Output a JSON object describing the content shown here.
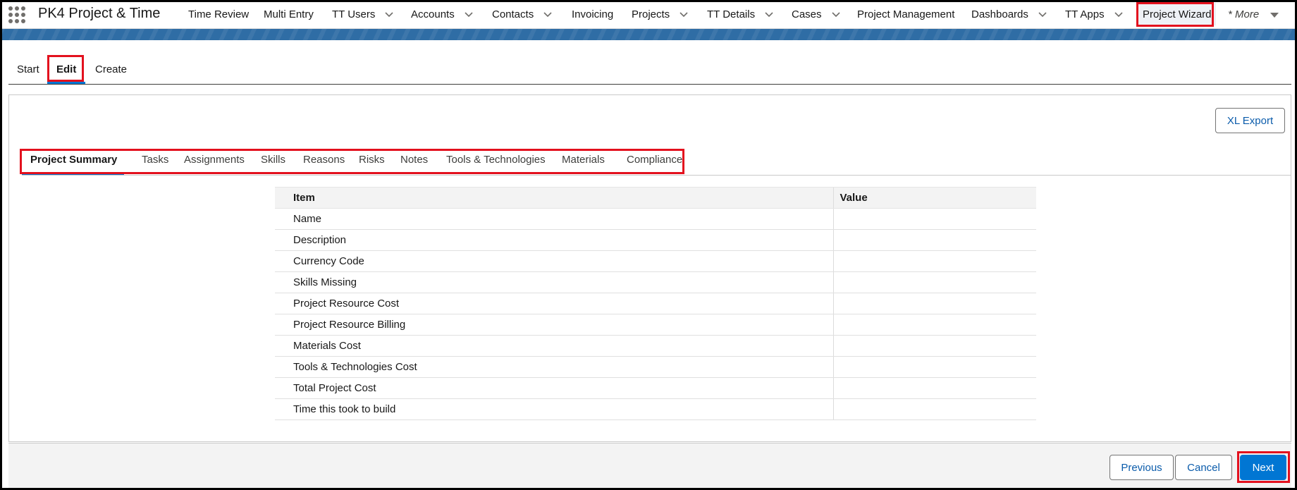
{
  "app": {
    "name": "PK4 Project & Time"
  },
  "nav": {
    "items": [
      {
        "label": "Time Review",
        "dropdown": false
      },
      {
        "label": "Multi Entry",
        "dropdown": false
      },
      {
        "label": "TT Users",
        "dropdown": true
      },
      {
        "label": "Accounts",
        "dropdown": true
      },
      {
        "label": "Contacts",
        "dropdown": true
      },
      {
        "label": "Invoicing",
        "dropdown": false
      },
      {
        "label": "Projects",
        "dropdown": true
      },
      {
        "label": "TT Details",
        "dropdown": true
      },
      {
        "label": "Cases",
        "dropdown": true
      },
      {
        "label": "Project Management",
        "dropdown": false
      },
      {
        "label": "Dashboards",
        "dropdown": true
      },
      {
        "label": "TT Apps",
        "dropdown": true
      },
      {
        "label": "Project Wizard",
        "dropdown": false,
        "active": true
      },
      {
        "label": "* More",
        "dropdown": true
      }
    ]
  },
  "wizard": {
    "tabs": [
      {
        "label": "Start"
      },
      {
        "label": "Edit",
        "active": true
      },
      {
        "label": "Create"
      }
    ]
  },
  "card": {
    "export_label": "XL Export",
    "sub_tabs": [
      {
        "label": "Project Summary",
        "active": true
      },
      {
        "label": "Tasks"
      },
      {
        "label": "Assignments"
      },
      {
        "label": "Skills"
      },
      {
        "label": "Reasons"
      },
      {
        "label": "Risks"
      },
      {
        "label": "Notes"
      },
      {
        "label": "Tools & Technologies"
      },
      {
        "label": "Materials"
      },
      {
        "label": "Compliance"
      }
    ],
    "table": {
      "headers": [
        "Item",
        "Value"
      ],
      "rows": [
        {
          "item": "Name",
          "value": ""
        },
        {
          "item": "Description",
          "value": ""
        },
        {
          "item": "Currency Code",
          "value": ""
        },
        {
          "item": "Skills Missing",
          "value": ""
        },
        {
          "item": "Project Resource Cost",
          "value": ""
        },
        {
          "item": "Project Resource Billing",
          "value": ""
        },
        {
          "item": "Materials Cost",
          "value": ""
        },
        {
          "item": "Tools & Technologies Cost",
          "value": ""
        },
        {
          "item": "Total Project Cost",
          "value": ""
        },
        {
          "item": "Time this took to build",
          "value": ""
        }
      ]
    }
  },
  "footer": {
    "previous_label": "Previous",
    "cancel_label": "Cancel",
    "next_label": "Next"
  },
  "colors": {
    "brand": "#0176d3",
    "highlight": "#e3111e",
    "banner": "#2f6da5"
  },
  "icons": {
    "app_launcher": "waffle-icon",
    "dropdown": "chevron-down-icon"
  }
}
